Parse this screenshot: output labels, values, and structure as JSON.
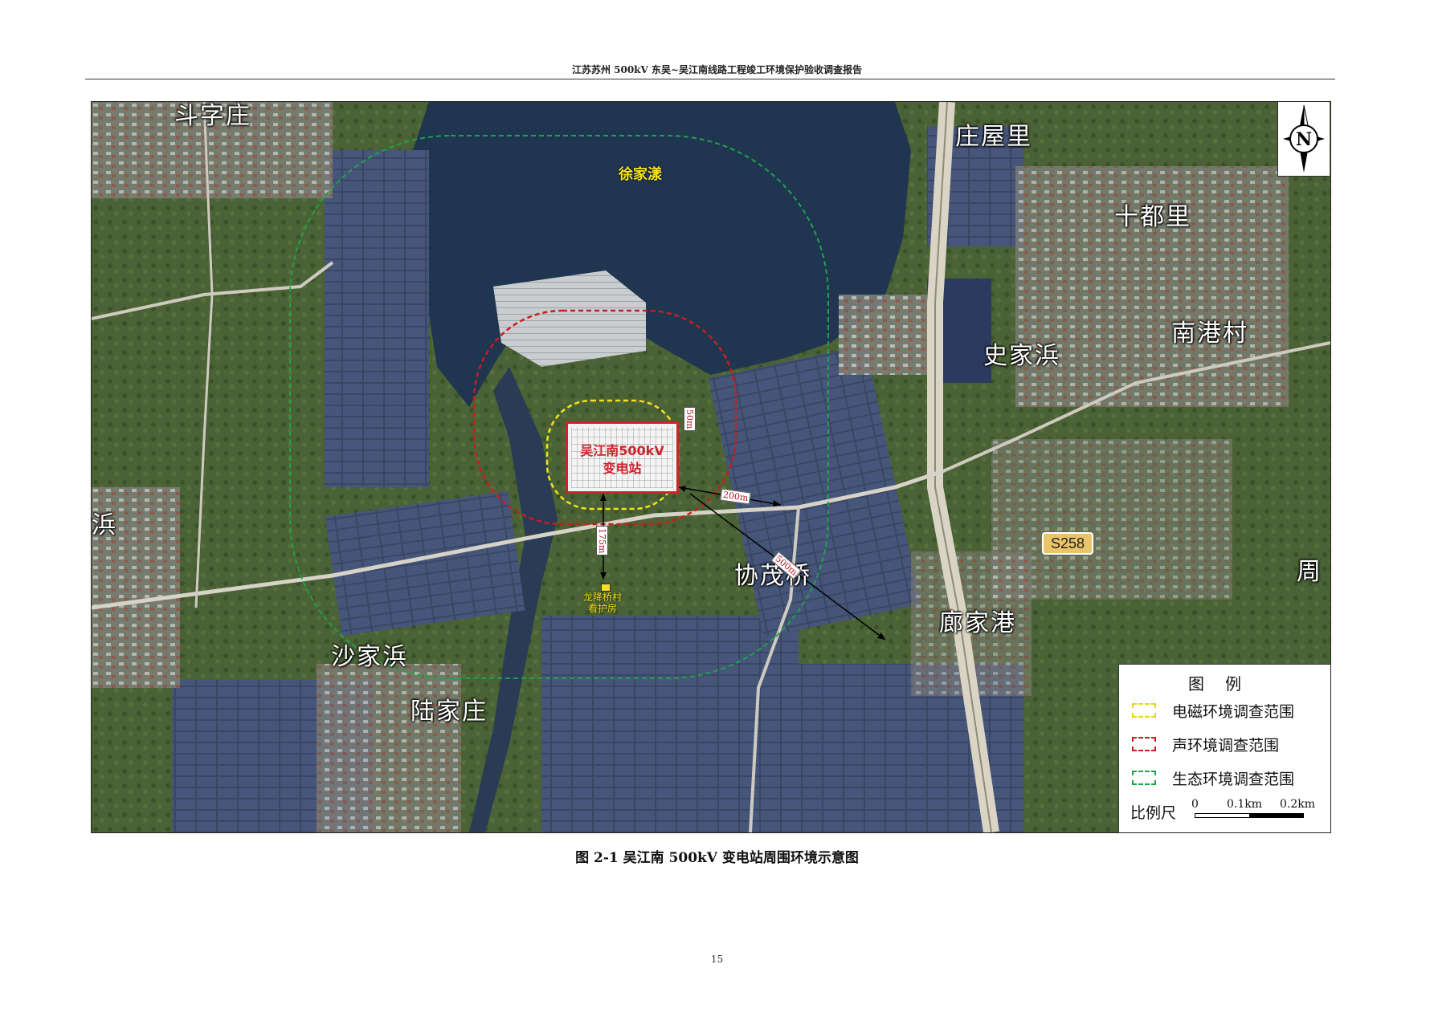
{
  "header": {
    "title": "江苏苏州 500kV 东吴~吴江南线路工程竣工环境保护验收调查报告"
  },
  "map": {
    "lake_label": "徐家漾",
    "place_names": {
      "douzizhuang": "斗字庄",
      "zhuangwuli": "庄屋里",
      "shiduli": "十都里",
      "nangangcun": "南港村",
      "shijiabang": "史家浜",
      "xiemaoqiao": "协茂桥",
      "langjiagang": "廊家港",
      "shajiabang": "沙家浜",
      "lujiazhuang": "陆家庄",
      "bang_edge": "浜",
      "zhou_edge": "周"
    },
    "road_badge": "S258",
    "substation": {
      "line1": "吴江南500kV",
      "line2": "变电站"
    },
    "distances": {
      "d50": "50m",
      "d175": "175m",
      "d200": "200m",
      "d500": "500m"
    },
    "guard_house": {
      "line1": "龙降桥村",
      "line2": "看护房"
    },
    "north_arrow_label": "N",
    "colors": {
      "em_range": "#f5e21a",
      "noise_range": "#c81e1e",
      "eco_range": "#1fa34a",
      "substation_border": "#d0222a",
      "water": "#1f3550",
      "vegetation": "#3e5a2a"
    },
    "legend": {
      "title": "图例",
      "items": [
        {
          "label": "电磁环境调查范围",
          "color": "#e8d21a"
        },
        {
          "label": "声环境调查范围",
          "color": "#c81e1e"
        },
        {
          "label": "生态环境调查范围",
          "color": "#1fa34a"
        }
      ],
      "scale_label": "比例尺",
      "scale_ticks": [
        "0",
        "0.1km",
        "0.2km"
      ]
    }
  },
  "caption": "图 2-1  吴江南 500kV 变电站周围环境示意图",
  "page_number": "15"
}
